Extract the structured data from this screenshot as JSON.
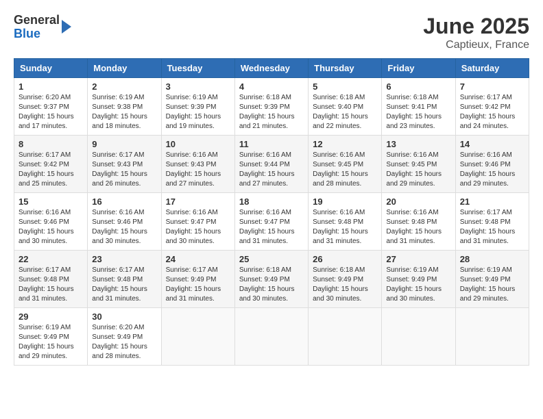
{
  "header": {
    "logo": {
      "general": "General",
      "blue": "Blue"
    },
    "title": "June 2025",
    "location": "Captieux, France"
  },
  "days_of_week": [
    "Sunday",
    "Monday",
    "Tuesday",
    "Wednesday",
    "Thursday",
    "Friday",
    "Saturday"
  ],
  "weeks": [
    [
      {
        "day": "1",
        "sunrise": "Sunrise: 6:20 AM",
        "sunset": "Sunset: 9:37 PM",
        "daylight": "Daylight: 15 hours and 17 minutes."
      },
      {
        "day": "2",
        "sunrise": "Sunrise: 6:19 AM",
        "sunset": "Sunset: 9:38 PM",
        "daylight": "Daylight: 15 hours and 18 minutes."
      },
      {
        "day": "3",
        "sunrise": "Sunrise: 6:19 AM",
        "sunset": "Sunset: 9:39 PM",
        "daylight": "Daylight: 15 hours and 19 minutes."
      },
      {
        "day": "4",
        "sunrise": "Sunrise: 6:18 AM",
        "sunset": "Sunset: 9:39 PM",
        "daylight": "Daylight: 15 hours and 21 minutes."
      },
      {
        "day": "5",
        "sunrise": "Sunrise: 6:18 AM",
        "sunset": "Sunset: 9:40 PM",
        "daylight": "Daylight: 15 hours and 22 minutes."
      },
      {
        "day": "6",
        "sunrise": "Sunrise: 6:18 AM",
        "sunset": "Sunset: 9:41 PM",
        "daylight": "Daylight: 15 hours and 23 minutes."
      },
      {
        "day": "7",
        "sunrise": "Sunrise: 6:17 AM",
        "sunset": "Sunset: 9:42 PM",
        "daylight": "Daylight: 15 hours and 24 minutes."
      }
    ],
    [
      {
        "day": "8",
        "sunrise": "Sunrise: 6:17 AM",
        "sunset": "Sunset: 9:42 PM",
        "daylight": "Daylight: 15 hours and 25 minutes."
      },
      {
        "day": "9",
        "sunrise": "Sunrise: 6:17 AM",
        "sunset": "Sunset: 9:43 PM",
        "daylight": "Daylight: 15 hours and 26 minutes."
      },
      {
        "day": "10",
        "sunrise": "Sunrise: 6:16 AM",
        "sunset": "Sunset: 9:43 PM",
        "daylight": "Daylight: 15 hours and 27 minutes."
      },
      {
        "day": "11",
        "sunrise": "Sunrise: 6:16 AM",
        "sunset": "Sunset: 9:44 PM",
        "daylight": "Daylight: 15 hours and 27 minutes."
      },
      {
        "day": "12",
        "sunrise": "Sunrise: 6:16 AM",
        "sunset": "Sunset: 9:45 PM",
        "daylight": "Daylight: 15 hours and 28 minutes."
      },
      {
        "day": "13",
        "sunrise": "Sunrise: 6:16 AM",
        "sunset": "Sunset: 9:45 PM",
        "daylight": "Daylight: 15 hours and 29 minutes."
      },
      {
        "day": "14",
        "sunrise": "Sunrise: 6:16 AM",
        "sunset": "Sunset: 9:46 PM",
        "daylight": "Daylight: 15 hours and 29 minutes."
      }
    ],
    [
      {
        "day": "15",
        "sunrise": "Sunrise: 6:16 AM",
        "sunset": "Sunset: 9:46 PM",
        "daylight": "Daylight: 15 hours and 30 minutes."
      },
      {
        "day": "16",
        "sunrise": "Sunrise: 6:16 AM",
        "sunset": "Sunset: 9:46 PM",
        "daylight": "Daylight: 15 hours and 30 minutes."
      },
      {
        "day": "17",
        "sunrise": "Sunrise: 6:16 AM",
        "sunset": "Sunset: 9:47 PM",
        "daylight": "Daylight: 15 hours and 30 minutes."
      },
      {
        "day": "18",
        "sunrise": "Sunrise: 6:16 AM",
        "sunset": "Sunset: 9:47 PM",
        "daylight": "Daylight: 15 hours and 31 minutes."
      },
      {
        "day": "19",
        "sunrise": "Sunrise: 6:16 AM",
        "sunset": "Sunset: 9:48 PM",
        "daylight": "Daylight: 15 hours and 31 minutes."
      },
      {
        "day": "20",
        "sunrise": "Sunrise: 6:16 AM",
        "sunset": "Sunset: 9:48 PM",
        "daylight": "Daylight: 15 hours and 31 minutes."
      },
      {
        "day": "21",
        "sunrise": "Sunrise: 6:17 AM",
        "sunset": "Sunset: 9:48 PM",
        "daylight": "Daylight: 15 hours and 31 minutes."
      }
    ],
    [
      {
        "day": "22",
        "sunrise": "Sunrise: 6:17 AM",
        "sunset": "Sunset: 9:48 PM",
        "daylight": "Daylight: 15 hours and 31 minutes."
      },
      {
        "day": "23",
        "sunrise": "Sunrise: 6:17 AM",
        "sunset": "Sunset: 9:48 PM",
        "daylight": "Daylight: 15 hours and 31 minutes."
      },
      {
        "day": "24",
        "sunrise": "Sunrise: 6:17 AM",
        "sunset": "Sunset: 9:49 PM",
        "daylight": "Daylight: 15 hours and 31 minutes."
      },
      {
        "day": "25",
        "sunrise": "Sunrise: 6:18 AM",
        "sunset": "Sunset: 9:49 PM",
        "daylight": "Daylight: 15 hours and 30 minutes."
      },
      {
        "day": "26",
        "sunrise": "Sunrise: 6:18 AM",
        "sunset": "Sunset: 9:49 PM",
        "daylight": "Daylight: 15 hours and 30 minutes."
      },
      {
        "day": "27",
        "sunrise": "Sunrise: 6:19 AM",
        "sunset": "Sunset: 9:49 PM",
        "daylight": "Daylight: 15 hours and 30 minutes."
      },
      {
        "day": "28",
        "sunrise": "Sunrise: 6:19 AM",
        "sunset": "Sunset: 9:49 PM",
        "daylight": "Daylight: 15 hours and 29 minutes."
      }
    ],
    [
      {
        "day": "29",
        "sunrise": "Sunrise: 6:19 AM",
        "sunset": "Sunset: 9:49 PM",
        "daylight": "Daylight: 15 hours and 29 minutes."
      },
      {
        "day": "30",
        "sunrise": "Sunrise: 6:20 AM",
        "sunset": "Sunset: 9:49 PM",
        "daylight": "Daylight: 15 hours and 28 minutes."
      },
      null,
      null,
      null,
      null,
      null
    ]
  ]
}
